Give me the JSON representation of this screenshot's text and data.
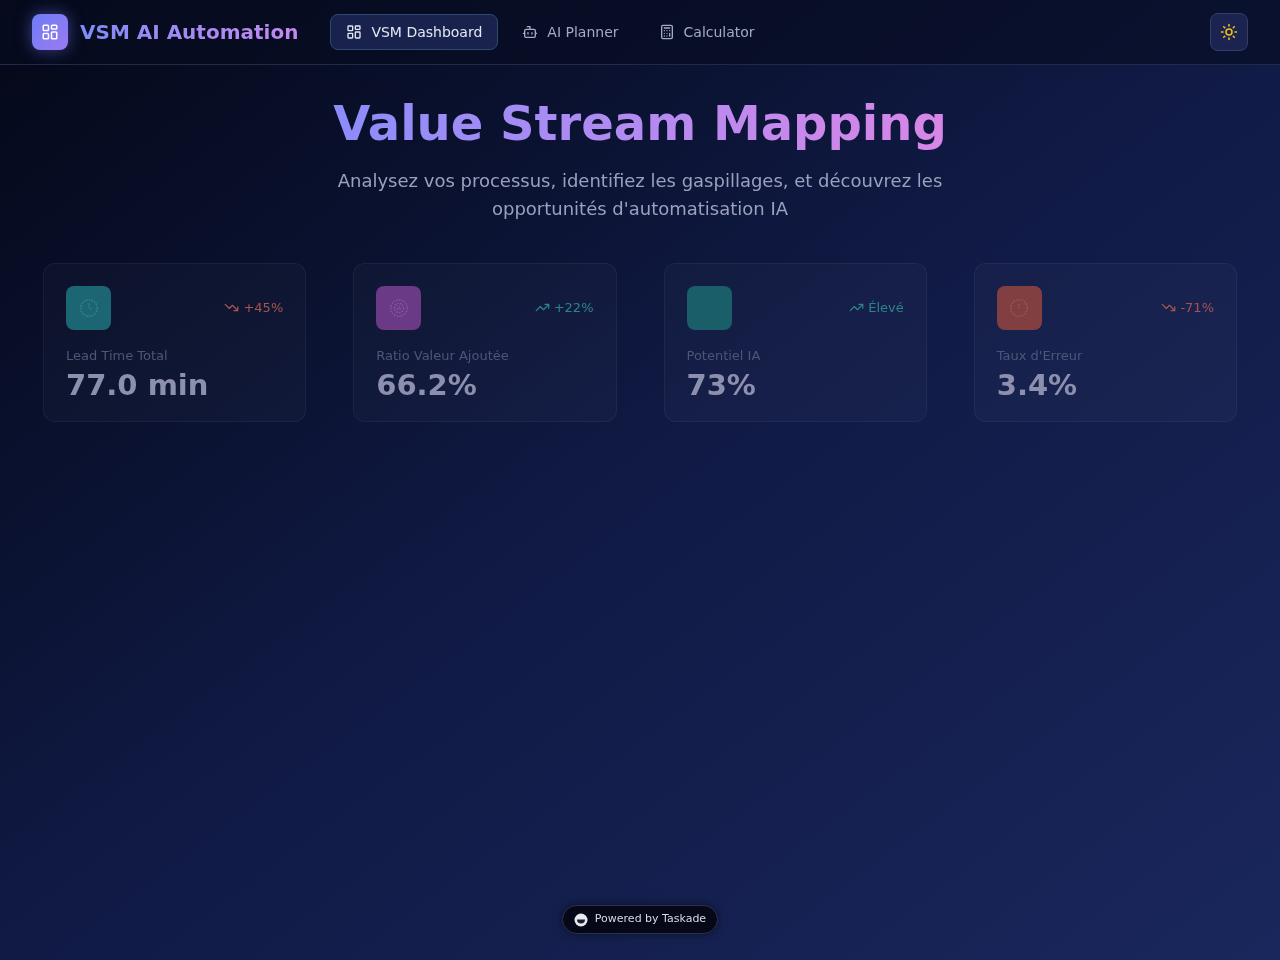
{
  "header": {
    "brand": "VSM AI Automation",
    "nav": [
      {
        "kind": "dashboard",
        "label": "VSM Dashboard",
        "selected": true
      },
      {
        "kind": "planner",
        "label": "AI Planner",
        "selected": false
      },
      {
        "kind": "calculator",
        "label": "Calculator",
        "selected": false
      }
    ]
  },
  "hero": {
    "title": "Value Stream Mapping",
    "subtitle": "Analysez vos processus, identifiez les gaspillages, et découvrez les opportunités d'automatisation IA"
  },
  "cards": [
    {
      "kind": "time",
      "color": "#1c6673",
      "label": "Lead Time Total",
      "value": "77.0 min",
      "trend": {
        "kind": "down",
        "text": "+45%"
      }
    },
    {
      "kind": "ratio",
      "color": "#6a3a86",
      "label": "Ratio Valeur Ajoutée",
      "value": "66.2%",
      "trend": {
        "kind": "up",
        "text": "+22%"
      }
    },
    {
      "kind": "potential",
      "color": "#195e69",
      "label": "Potentiel IA",
      "value": "73%",
      "trend": {
        "kind": "up",
        "text": "Élevé"
      }
    },
    {
      "kind": "error",
      "color": "#823f42",
      "label": "Taux d'Erreur",
      "value": "3.4%",
      "trend": {
        "kind": "down",
        "text": "-71%"
      }
    }
  ],
  "footer": {
    "badge": "Powered by Taskade"
  }
}
